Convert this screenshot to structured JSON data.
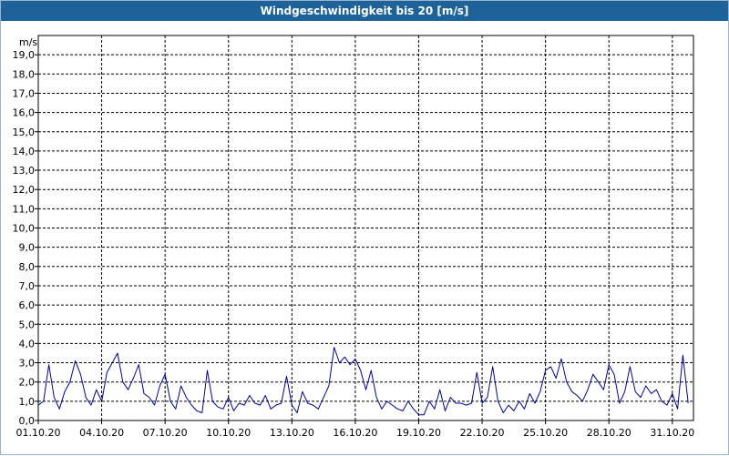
{
  "title": "Windgeschwindigkeit bis 20 [m/s]",
  "chart_data": {
    "type": "line",
    "title": "Windgeschwindigkeit bis 20 [m/s]",
    "ylabel": "m/s",
    "xlabel": "",
    "ylim": [
      0,
      20
    ],
    "xlim": [
      "01.10.20 00:00",
      "01.11.20 00:00"
    ],
    "grid": true,
    "legend": "none",
    "colors": {
      "line": "#00009c",
      "grid": "#000000",
      "axis": "#000000",
      "title_bar": "#1d6299"
    },
    "y_ticks": [
      "0,0",
      "1,0",
      "2,0",
      "3,0",
      "4,0",
      "5,0",
      "6,0",
      "7,0",
      "8,0",
      "9,0",
      "10,0",
      "11,0",
      "12,0",
      "13,0",
      "14,0",
      "15,0",
      "16,0",
      "17,0",
      "18,0",
      "19,0"
    ],
    "x_ticks": [
      "01.10.20",
      "04.10.20",
      "07.10.20",
      "10.10.20",
      "13.10.20",
      "16.10.20",
      "19.10.20",
      "22.10.20",
      "25.10.20",
      "28.10.20",
      "31.10.20"
    ],
    "series": [
      {
        "x": [
          "01.10.20 00:00",
          "01.10.20 06:00",
          "01.10.20 12:00",
          "01.10.20 18:00",
          "02.10.20 00:00",
          "02.10.20 06:00",
          "02.10.20 12:00",
          "02.10.20 18:00",
          "03.10.20 00:00",
          "03.10.20 06:00",
          "03.10.20 12:00",
          "03.10.20 18:00",
          "04.10.20 00:00",
          "04.10.20 06:00",
          "04.10.20 12:00",
          "04.10.20 18:00",
          "05.10.20 00:00",
          "05.10.20 06:00",
          "05.10.20 12:00",
          "05.10.20 18:00",
          "06.10.20 00:00",
          "06.10.20 06:00",
          "06.10.20 12:00",
          "06.10.20 18:00",
          "07.10.20 00:00",
          "07.10.20 06:00",
          "07.10.20 12:00",
          "07.10.20 18:00",
          "08.10.20 00:00",
          "08.10.20 06:00",
          "08.10.20 12:00",
          "08.10.20 18:00",
          "09.10.20 00:00",
          "09.10.20 06:00",
          "09.10.20 12:00",
          "09.10.20 18:00",
          "10.10.20 00:00",
          "10.10.20 06:00",
          "10.10.20 12:00",
          "10.10.20 18:00",
          "11.10.20 00:00",
          "11.10.20 06:00",
          "11.10.20 12:00",
          "11.10.20 18:00",
          "12.10.20 00:00",
          "12.10.20 06:00",
          "12.10.20 12:00",
          "12.10.20 18:00",
          "13.10.20 00:00",
          "13.10.20 06:00",
          "13.10.20 12:00",
          "13.10.20 18:00",
          "14.10.20 00:00",
          "14.10.20 06:00",
          "14.10.20 12:00",
          "14.10.20 18:00",
          "15.10.20 00:00",
          "15.10.20 06:00",
          "15.10.20 12:00",
          "15.10.20 18:00",
          "16.10.20 00:00",
          "16.10.20 06:00",
          "16.10.20 12:00",
          "16.10.20 18:00",
          "17.10.20 00:00",
          "17.10.20 06:00",
          "17.10.20 12:00",
          "17.10.20 18:00",
          "18.10.20 00:00",
          "18.10.20 06:00",
          "18.10.20 12:00",
          "18.10.20 18:00",
          "19.10.20 00:00",
          "19.10.20 06:00",
          "19.10.20 12:00",
          "19.10.20 18:00",
          "20.10.20 00:00",
          "20.10.20 06:00",
          "20.10.20 12:00",
          "20.10.20 18:00",
          "21.10.20 00:00",
          "21.10.20 06:00",
          "21.10.20 12:00",
          "21.10.20 18:00",
          "22.10.20 00:00",
          "22.10.20 06:00",
          "22.10.20 12:00",
          "22.10.20 18:00",
          "23.10.20 00:00",
          "23.10.20 06:00",
          "23.10.20 12:00",
          "23.10.20 18:00",
          "24.10.20 00:00",
          "24.10.20 06:00",
          "24.10.20 12:00",
          "24.10.20 18:00",
          "25.10.20 00:00",
          "25.10.20 06:00",
          "25.10.20 12:00",
          "25.10.20 18:00",
          "26.10.20 00:00",
          "26.10.20 06:00",
          "26.10.20 12:00",
          "26.10.20 18:00",
          "27.10.20 00:00",
          "27.10.20 06:00",
          "27.10.20 12:00",
          "27.10.20 18:00",
          "28.10.20 00:00",
          "28.10.20 06:00",
          "28.10.20 12:00",
          "28.10.20 18:00",
          "29.10.20 00:00",
          "29.10.20 06:00",
          "29.10.20 12:00",
          "29.10.20 18:00",
          "30.10.20 00:00",
          "30.10.20 06:00",
          "30.10.20 12:00",
          "30.10.20 18:00",
          "31.10.20 00:00",
          "31.10.20 06:00",
          "31.10.20 12:00",
          "31.10.20 18:00"
        ],
        "y": [
          0.8,
          1.0,
          2.9,
          1.2,
          0.6,
          1.5,
          2.0,
          3.1,
          2.4,
          1.2,
          0.8,
          1.6,
          1.0,
          2.5,
          3.0,
          3.5,
          2.0,
          1.6,
          2.2,
          2.9,
          1.4,
          1.2,
          0.8,
          1.8,
          2.4,
          1.0,
          0.6,
          1.8,
          1.2,
          0.8,
          0.5,
          0.4,
          2.6,
          1.0,
          0.7,
          0.6,
          1.2,
          0.5,
          0.9,
          0.8,
          1.3,
          0.9,
          0.8,
          1.3,
          0.6,
          0.8,
          0.9,
          2.3,
          0.8,
          0.4,
          1.5,
          0.9,
          0.8,
          0.6,
          1.2,
          1.8,
          3.8,
          3.0,
          3.3,
          2.9,
          3.2,
          2.6,
          1.6,
          2.6,
          1.2,
          0.6,
          1.0,
          0.8,
          0.6,
          0.5,
          1.0,
          0.6,
          0.3,
          0.3,
          1.0,
          0.6,
          1.6,
          0.5,
          1.2,
          0.9,
          0.9,
          0.8,
          0.9,
          2.5,
          0.9,
          1.2,
          2.8,
          1.0,
          0.4,
          0.8,
          0.5,
          1.0,
          0.6,
          1.4,
          0.9,
          1.5,
          2.6,
          2.8,
          2.2,
          3.2,
          2.0,
          1.5,
          1.3,
          1.0,
          1.6,
          2.4,
          2.0,
          1.6,
          2.9,
          2.4,
          0.9,
          1.5,
          2.8,
          1.5,
          1.2,
          1.8,
          1.4,
          1.6,
          1.0,
          0.8,
          1.4,
          0.6,
          3.4,
          0.9
        ]
      }
    ]
  }
}
